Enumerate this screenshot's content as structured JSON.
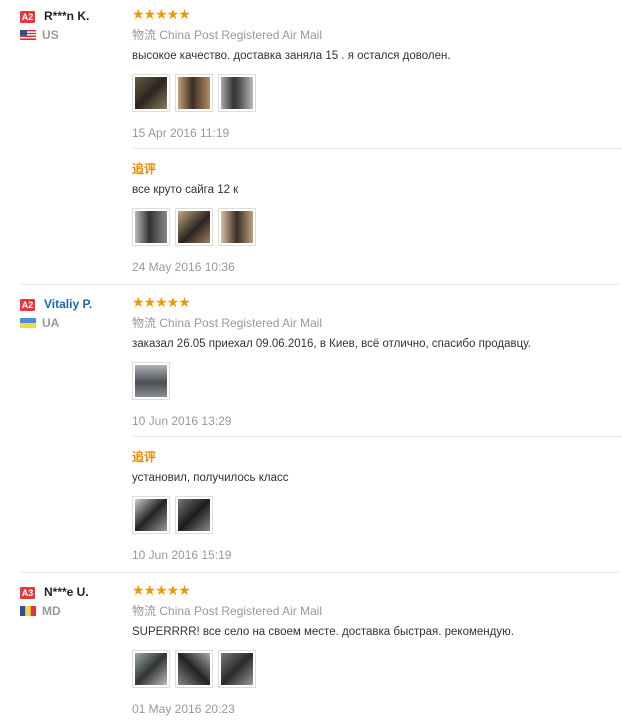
{
  "shipping_prefix": "物流",
  "followup_label": "追评",
  "stars": "★★★★★",
  "reviews": [
    {
      "level": "A2",
      "name": "R***n K.",
      "country": "US",
      "shipping": "China Post Registered Air Mail",
      "text": "высокое качество. доставка заняла 15 . я остался доволен.",
      "photos": [
        "photo-1",
        "photo-2",
        "photo-3"
      ],
      "date": "15 Apr 2016 11:19",
      "followup_text": "все круто сайга 12 к",
      "followup_photos": [
        "photo-1",
        "photo-2",
        "photo-3"
      ],
      "followup_date": "24 May 2016 10:36"
    },
    {
      "level": "A2",
      "name": "Vitaliy P.",
      "country": "UA",
      "shipping": "China Post Registered Air Mail",
      "text": "заказал 26.05 приехал 09.06.2016, в Киев, всё отлично, спасибо продавцу.",
      "photos": [
        "photo-1"
      ],
      "date": "10 Jun 2016 13:29",
      "followup_text": "установил, получилось класс",
      "followup_photos": [
        "photo-1",
        "photo-2"
      ],
      "followup_date": "10 Jun 2016 15:19"
    },
    {
      "level": "A3",
      "name": "N***e U.",
      "country": "MD",
      "shipping": "China Post Registered Air Mail",
      "text": "SUPERRRR! все село на своем месте. доставка быстрая. рекомендую.",
      "photos": [
        "photo-1",
        "photo-2",
        "photo-3"
      ],
      "date": "01 May 2016 20:23"
    }
  ],
  "colors": {
    "badge": "#e4393c",
    "stars": "#f39800",
    "followup": "#e88b00",
    "name_link": "#1a66b5"
  }
}
